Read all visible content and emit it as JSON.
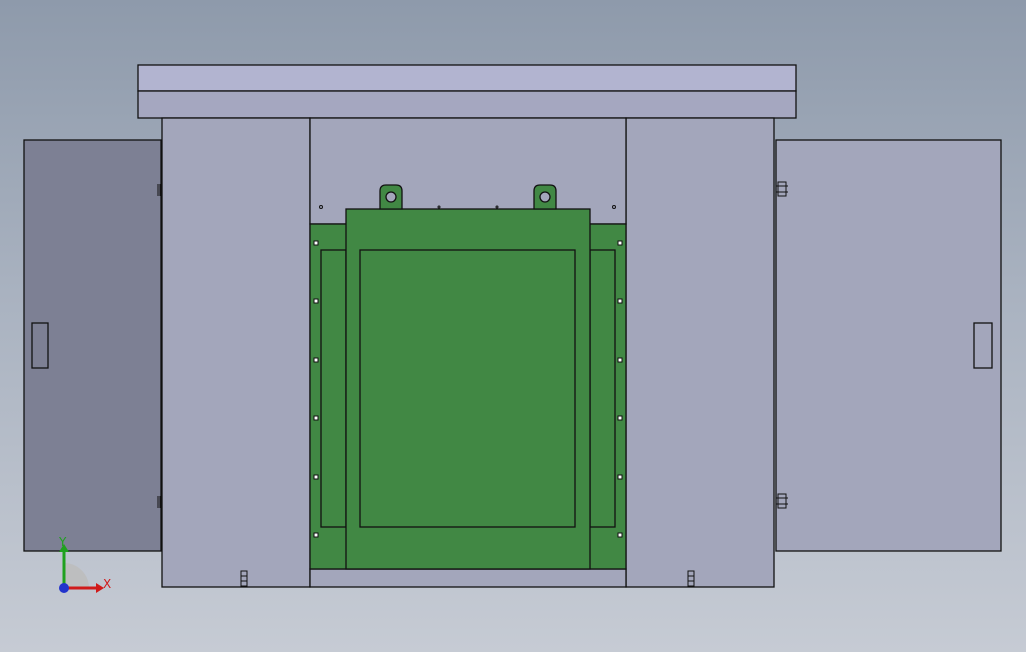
{
  "viewport": {
    "background_top": "#8e9aab",
    "background_bottom": "#c6cbd4"
  },
  "model": {
    "panel_color": "#a3a6bb",
    "roof_color": "#b2b4d0",
    "left_door_color": "#7d8094",
    "transformer_color": "#418844",
    "outline_color": "#111111"
  },
  "triad": {
    "x_label": "X",
    "y_label": "Y",
    "x_color": "#d01a1a",
    "y_color": "#1fa11f",
    "z_color": "#2233cc"
  }
}
